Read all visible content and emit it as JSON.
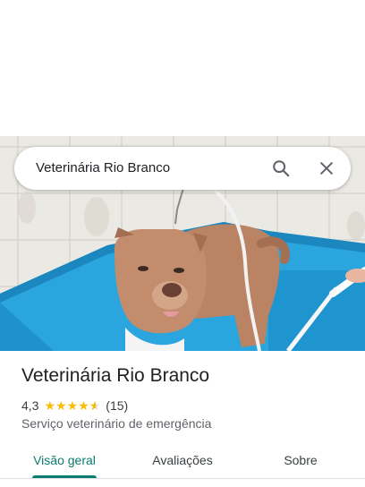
{
  "search": {
    "query": "Veterinária Rio Branco"
  },
  "place": {
    "name": "Veterinária Rio Branco",
    "rating": "4,3",
    "rating_value": 4.3,
    "reviews_count": "(15)",
    "category": "Serviço veterinário de emergência"
  },
  "tabs": [
    {
      "label": "Visão geral",
      "active": true
    },
    {
      "label": "Avaliações",
      "active": false
    },
    {
      "label": "Sobre",
      "active": false
    }
  ],
  "colors": {
    "accent": "#0b7c6f",
    "star": "#fbbc04",
    "tub": "#1f9fd8"
  },
  "icons": {
    "search": "search-icon",
    "close": "close-icon",
    "star": "star-icon"
  }
}
